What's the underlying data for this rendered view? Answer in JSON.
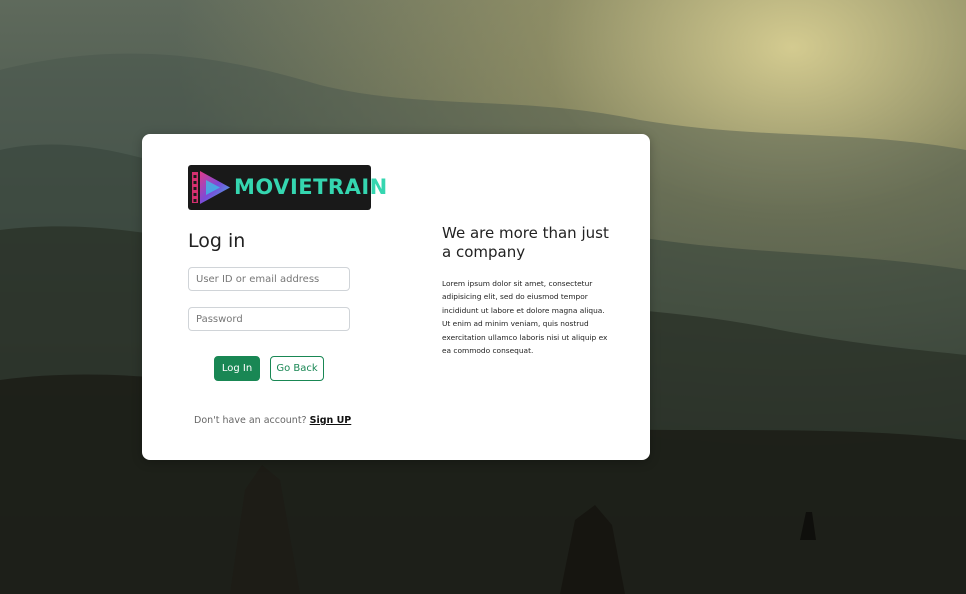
{
  "brand": {
    "name": "MOVIETRAIN",
    "text_color": "#35d6b0",
    "logo_bg": "#191919"
  },
  "login": {
    "title": "Log in",
    "user_placeholder": "User ID or email address",
    "password_placeholder": "Password",
    "login_button": "Log In",
    "back_button": "Go Back",
    "no_account_text": "Don't have an account?",
    "signup_link": "Sign UP"
  },
  "info": {
    "title": "We are more than just a company",
    "body": "Lorem ipsum dolor sit amet, consectetur adipisicing elit, sed do eiusmod tempor incididunt ut labore et dolore magna aliqua. Ut enim ad minim veniam, quis nostrud exercitation ullamco laboris nisi ut aliquip ex ea commodo consequat."
  },
  "colors": {
    "primary_button": "#198754",
    "card_bg": "#ffffff"
  }
}
